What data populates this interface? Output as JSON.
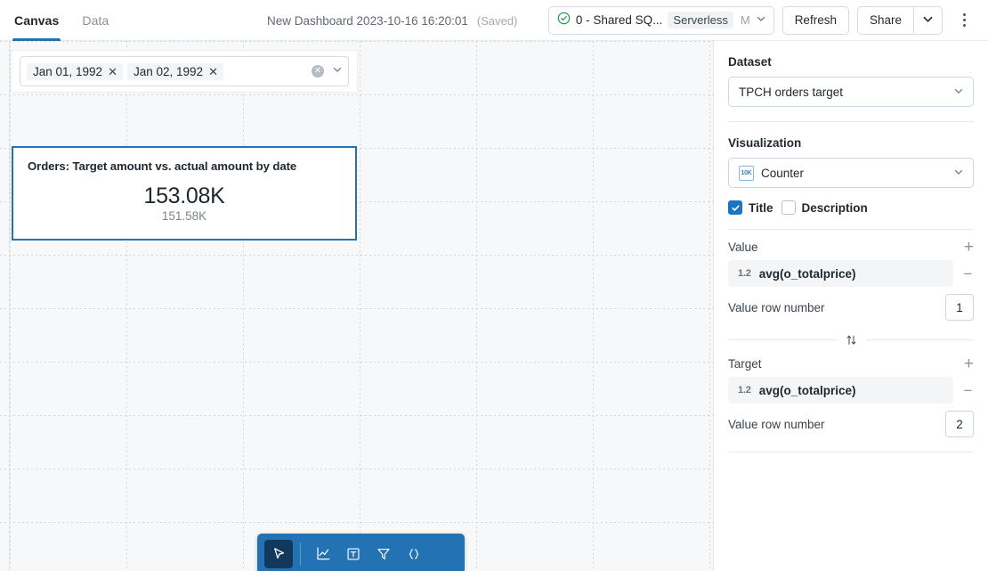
{
  "header": {
    "tabs": [
      {
        "label": "Canvas",
        "active": true
      },
      {
        "label": "Data",
        "active": false
      }
    ],
    "dashboard_title": "New Dashboard 2023-10-16 16:20:01",
    "saved_label": "(Saved)",
    "compute": {
      "status_icon": "check-circle-icon",
      "name": "0 - Shared SQ...",
      "badge": "Serverless",
      "size": "M",
      "caret_icon": "chevron-down-icon"
    },
    "refresh_label": "Refresh",
    "share_label": "Share",
    "share_caret_icon": "chevron-down-icon",
    "overflow_icon": "kebab-menu-icon"
  },
  "canvas": {
    "filter_widget": {
      "chips": [
        {
          "label": "Jan 01, 1992",
          "remove_icon": "close-icon"
        },
        {
          "label": "Jan 02, 1992",
          "remove_icon": "close-icon"
        }
      ],
      "clear_icon": "clear-circle-icon",
      "caret_icon": "chevron-down-icon"
    },
    "counter_widget": {
      "title": "Orders: Target amount vs. actual amount by date",
      "value": "153.08K",
      "target": "151.58K"
    },
    "toolbar": {
      "tools": [
        {
          "name": "cursor-tool",
          "icon": "cursor-icon",
          "active": true
        },
        {
          "name": "chart-tool",
          "icon": "line-chart-icon",
          "active": false
        },
        {
          "name": "text-tool",
          "icon": "text-box-icon",
          "active": false
        },
        {
          "name": "filter-tool",
          "icon": "funnel-icon",
          "active": false
        },
        {
          "name": "code-tool",
          "icon": "code-brackets-icon",
          "active": false
        }
      ]
    }
  },
  "panel": {
    "dataset": {
      "label": "Dataset",
      "value": "TPCH orders target",
      "caret_icon": "chevron-down-icon"
    },
    "visualization": {
      "label": "Visualization",
      "value": "Counter",
      "icon_text": "10K",
      "caret_icon": "chevron-down-icon",
      "toggles": [
        {
          "label": "Title",
          "checked": true
        },
        {
          "label": "Description",
          "checked": false
        }
      ]
    },
    "value_section": {
      "label": "Value",
      "add_icon": "plus-icon",
      "field": {
        "type_icon": "1.2",
        "name": "avg(o_totalprice)",
        "remove_icon": "minus-icon"
      },
      "row_number_label": "Value row number",
      "row_number_value": "1"
    },
    "swap_icon": "swap-vertical-icon",
    "target_section": {
      "label": "Target",
      "add_icon": "plus-icon",
      "field": {
        "type_icon": "1.2",
        "name": "avg(o_totalprice)",
        "remove_icon": "minus-icon"
      },
      "row_number_label": "Value row number",
      "row_number_value": "2"
    }
  },
  "colors": {
    "accent": "#2272b4",
    "toolbar_active": "#12395c",
    "checkbox_on": "#1c72c4",
    "status_green": "#1d9a52"
  }
}
